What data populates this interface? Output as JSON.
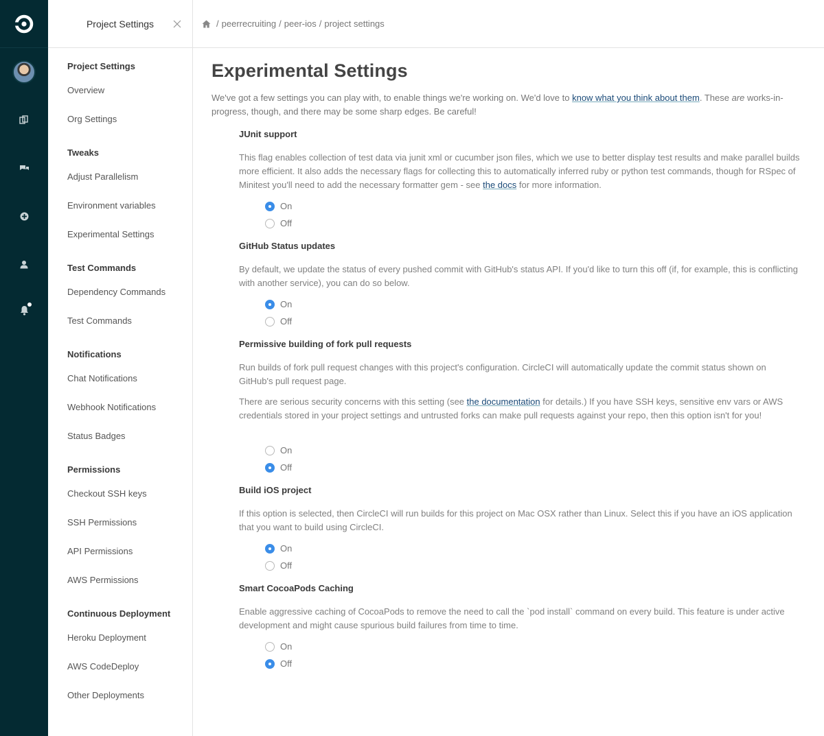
{
  "breadcrumb": {
    "items": [
      "peerrecruiting",
      "peer-ios",
      "project settings"
    ],
    "separator": "/"
  },
  "sidebar": {
    "title": "Project Settings",
    "sections": [
      {
        "title": "Project Settings",
        "items": [
          "Overview",
          "Org Settings"
        ]
      },
      {
        "title": "Tweaks",
        "items": [
          "Adjust Parallelism",
          "Environment variables",
          "Experimental Settings"
        ]
      },
      {
        "title": "Test Commands",
        "items": [
          "Dependency Commands",
          "Test Commands"
        ]
      },
      {
        "title": "Notifications",
        "items": [
          "Chat Notifications",
          "Webhook Notifications",
          "Status Badges"
        ]
      },
      {
        "title": "Permissions",
        "items": [
          "Checkout SSH keys",
          "SSH Permissions",
          "API Permissions",
          "AWS Permissions"
        ]
      },
      {
        "title": "Continuous Deployment",
        "items": [
          "Heroku Deployment",
          "AWS CodeDeploy",
          "Other Deployments"
        ]
      }
    ]
  },
  "rail": {
    "icons": [
      "circleci-logo-icon",
      "avatar",
      "builds-icon",
      "chat-icon",
      "add-project-icon",
      "user-icon",
      "bell-icon"
    ]
  },
  "main": {
    "title": "Experimental Settings",
    "intro": {
      "part1": "We've got a few settings you can play with, to enable things we're working on. We'd love to ",
      "link": "know what you think about them",
      "part2": ". These ",
      "emphasis": "are",
      "part3": " works-in-progress, though, and there may be some sharp edges. Be careful!"
    },
    "settings": [
      {
        "title": "JUnit support",
        "desc": "This flag enables collection of test data via junit xml or cucumber json files, which we use to better display test results and make parallel builds more efficient. It also adds the necessary flags for collecting this to automatically inferred ruby or python test commands, though for RSpec of Minitest you'll need to add the necessary formatter gem - see ",
        "desc_link": "the docs",
        "desc_after": " for more information.",
        "on_label": "On",
        "off_label": "Off",
        "selected": "On"
      },
      {
        "title": "GitHub Status updates",
        "desc": "By default, we update the status of every pushed commit with GitHub's status API. If you'd like to turn this off (if, for example, this is conflicting with another service), you can do so below.",
        "on_label": "On",
        "off_label": "Off",
        "selected": "On"
      },
      {
        "title": "Permissive building of fork pull requests",
        "desc": "Run builds of fork pull request changes with this project's configuration. CircleCI will automatically update the commit status shown on GitHub's pull request page.",
        "desc2_before": "There are serious security concerns with this setting (see ",
        "desc2_link": "the documentation",
        "desc2_after": " for details.) If you have SSH keys, sensitive env vars or AWS credentials stored in your project settings and untrusted forks can make pull requests against your repo, then this option isn't for you!",
        "on_label": "On",
        "off_label": "Off",
        "selected": "Off"
      },
      {
        "title": "Build iOS project",
        "desc": "If this option is selected, then CircleCI will run builds for this project on Mac OSX rather than Linux. Select this if you have an iOS application that you want to build using CircleCI.",
        "on_label": "On",
        "off_label": "Off",
        "selected": "On"
      },
      {
        "title": "Smart CocoaPods Caching",
        "desc": "Enable aggressive caching of CocoaPods to remove the need to call the `pod install` command on every build. This feature is under active development and might cause spurious build failures from time to time.",
        "on_label": "On",
        "off_label": "Off",
        "selected": "Off"
      }
    ]
  },
  "colors": {
    "rail": "#042a32",
    "accent": "#3a8de8",
    "link": "#1a4a78"
  }
}
